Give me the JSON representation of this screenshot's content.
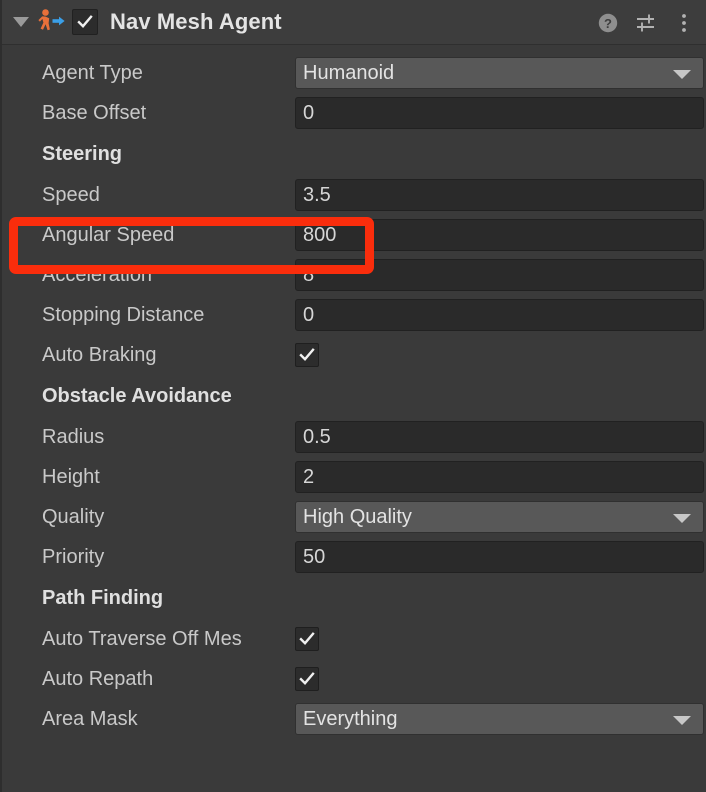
{
  "header": {
    "title": "Nav Mesh Agent",
    "enabled_checkbox": "✓",
    "foldout_state": "expanded",
    "icon_name": "nav-mesh-agent-icon",
    "help_label": "?",
    "colors": {
      "icon_person": "#e8703a",
      "icon_arrow": "#3a9fe8",
      "header_bg": "#3d3d3d"
    }
  },
  "properties": {
    "agent_type": {
      "label": "Agent Type",
      "value": "Humanoid",
      "type": "popup"
    },
    "base_offset": {
      "label": "Base Offset",
      "value": "0",
      "type": "number"
    }
  },
  "sections": {
    "steering": {
      "title": "Steering",
      "rows": [
        {
          "label": "Speed",
          "value": "3.5",
          "type": "number"
        },
        {
          "label": "Angular Speed",
          "value": "800",
          "type": "number"
        },
        {
          "label": "Acceleration",
          "value": "8",
          "type": "number"
        },
        {
          "label": "Stopping Distance",
          "value": "0",
          "type": "number"
        },
        {
          "label": "Auto Braking",
          "value": "✓",
          "type": "checkbox"
        }
      ]
    },
    "obstacle_avoidance": {
      "title": "Obstacle Avoidance",
      "rows": [
        {
          "label": "Radius",
          "value": "0.5",
          "type": "number"
        },
        {
          "label": "Height",
          "value": "2",
          "type": "number"
        },
        {
          "label": "Quality",
          "value": "High Quality",
          "type": "popup"
        },
        {
          "label": "Priority",
          "value": "50",
          "type": "number"
        }
      ]
    },
    "path_finding": {
      "title": "Path Finding",
      "rows": [
        {
          "label": "Auto Traverse Off Mes",
          "value": "✓",
          "type": "checkbox"
        },
        {
          "label": "Auto Repath",
          "value": "✓",
          "type": "checkbox"
        },
        {
          "label": "Area Mask",
          "value": "Everything",
          "type": "popup"
        }
      ]
    }
  },
  "annotation": {
    "color": "#fa2d0c",
    "target_label": "Angular Speed",
    "target_value": "800"
  }
}
